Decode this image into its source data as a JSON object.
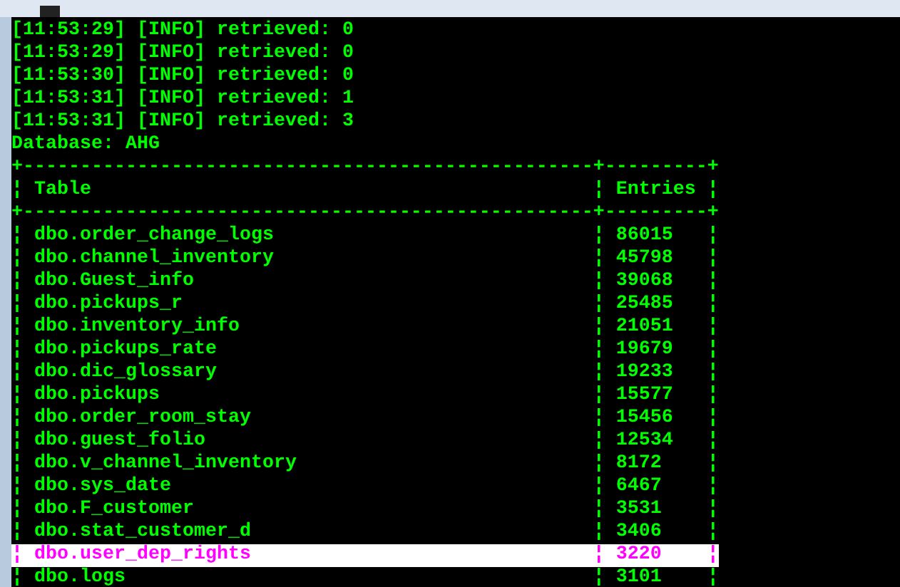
{
  "log_lines": [
    "[11:53:29] [INFO] retrieved: 0",
    "[11:53:29] [INFO] retrieved: 0",
    "[11:53:30] [INFO] retrieved: 0",
    "[11:53:31] [INFO] retrieved: 1",
    "[11:53:31] [INFO] retrieved: 3",
    "Database: AHG"
  ],
  "table": {
    "border": "+--------------------------------------------------+---------+",
    "separator": "¦",
    "columns": [
      "Table",
      "Entries"
    ],
    "rows": [
      {
        "name": "dbo.order_change_logs",
        "entries": "86015",
        "selected": false
      },
      {
        "name": "dbo.channel_inventory",
        "entries": "45798",
        "selected": false
      },
      {
        "name": "dbo.Guest_info",
        "entries": "39068",
        "selected": false
      },
      {
        "name": "dbo.pickups_r",
        "entries": "25485",
        "selected": false
      },
      {
        "name": "dbo.inventory_info",
        "entries": "21051",
        "selected": false
      },
      {
        "name": "dbo.pickups_rate",
        "entries": "19679",
        "selected": false
      },
      {
        "name": "dbo.dic_glossary",
        "entries": "19233",
        "selected": false
      },
      {
        "name": "dbo.pickups",
        "entries": "15577",
        "selected": false
      },
      {
        "name": "dbo.order_room_stay",
        "entries": "15456",
        "selected": false
      },
      {
        "name": "dbo.guest_folio",
        "entries": "12534",
        "selected": false
      },
      {
        "name": "dbo.v_channel_inventory",
        "entries": "8172",
        "selected": false
      },
      {
        "name": "dbo.sys_date",
        "entries": "6467",
        "selected": false
      },
      {
        "name": "dbo.F_customer",
        "entries": "3531",
        "selected": false
      },
      {
        "name": "dbo.stat_customer_d",
        "entries": "3406",
        "selected": false
      },
      {
        "name": "dbo.user_dep_rights",
        "entries": "3220",
        "selected": true
      },
      {
        "name": "dbo.logs",
        "entries": "3101",
        "selected": false
      }
    ]
  }
}
